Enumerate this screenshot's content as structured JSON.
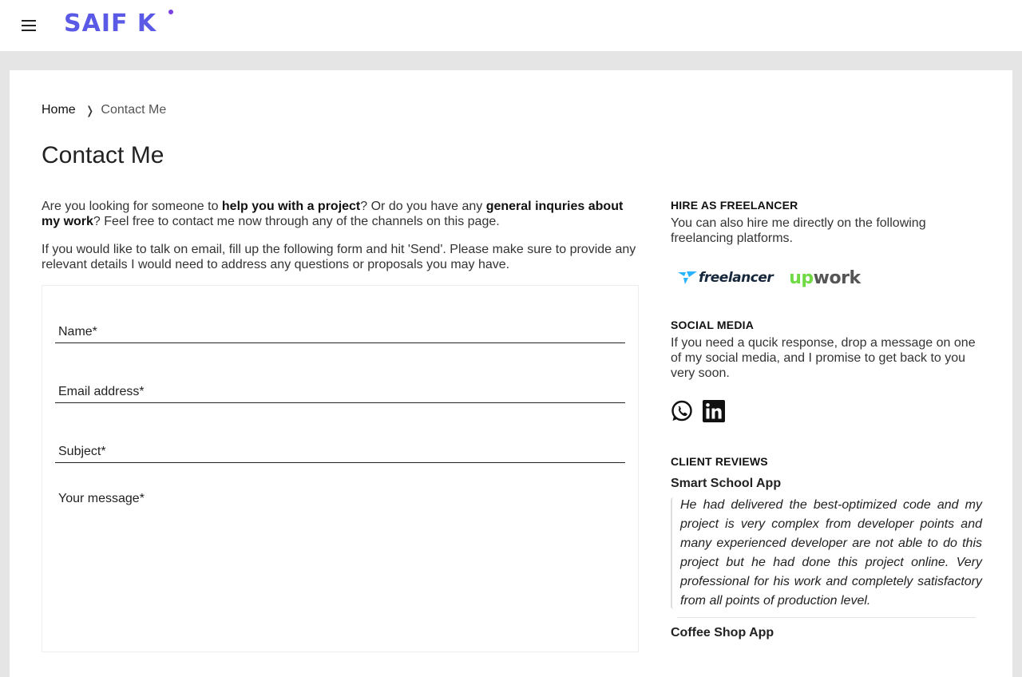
{
  "header": {
    "logo_text": "SAIF K",
    "brand_color": "#5a5ae6"
  },
  "breadcrumb": {
    "home": "Home",
    "separator": "❭",
    "current": "Contact Me"
  },
  "page_title": "Contact Me",
  "intro": {
    "p1_a": "Are you looking for someone to ",
    "p1_b": "help you with a project",
    "p1_c": "? Or do you have any ",
    "p1_d": "general inquries about my work",
    "p1_e": "? Feel free to contact me now through any of the channels on this page.",
    "p2": "If you would like to talk on email, fill up the following form and hit 'Send'. Please make sure to provide any relevant details I would need to address any questions or proposals you may have."
  },
  "form": {
    "name_placeholder": "Name*",
    "email_placeholder": "Email address*",
    "subject_placeholder": "Subject*",
    "message_placeholder": "Your message*"
  },
  "sidebar": {
    "hire_heading": "HIRE AS FREELANCER",
    "hire_text": "You can also hire me directly on the following freelancing platforms.",
    "platforms": {
      "freelancer": "freelancer",
      "upwork_up": "up",
      "upwork_work": "work"
    },
    "social_heading": "SOCIAL MEDIA",
    "social_text": "If you need a qucik response, drop a message on one of my social media, and I promise to get back to you very soon.",
    "social_icons": [
      "whatsapp-icon",
      "linkedin-icon"
    ],
    "reviews_heading": "CLIENT REVIEWS",
    "reviews": [
      {
        "title": "Smart School App",
        "quote": "He had delivered the best-optimized code and my project is very complex from developer points and many experienced developer are not able to do this project but he had done this project online. Very professional for his work and completely satisfactory from all points of production level."
      },
      {
        "title": "Coffee Shop App",
        "quote": ""
      }
    ]
  }
}
